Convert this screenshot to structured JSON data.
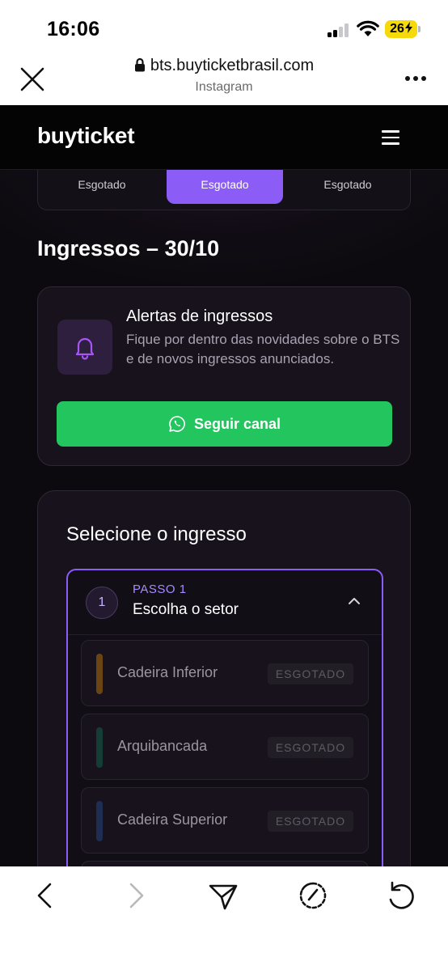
{
  "status_bar": {
    "time": "16:06",
    "battery": "26",
    "icons": [
      "cellular-signal-icon",
      "wifi-icon",
      "battery-charging-icon"
    ]
  },
  "browser": {
    "url": "bts.buyticketbrasil.com",
    "source": "Instagram",
    "icons": [
      "close-icon",
      "lock-icon",
      "more-icon"
    ]
  },
  "site": {
    "logo": "buyticket",
    "accent_color": "#8b5cf6",
    "tabs": [
      {
        "label": "Esgotado"
      },
      {
        "label": "Esgotado"
      },
      {
        "label": "Esgotado"
      }
    ],
    "section_title": "Ingressos – 30/10"
  },
  "alert": {
    "title": "Alertas de ingressos",
    "description": "Fique por dentro das novidades sobre o BTS e de novos ingressos anunciados.",
    "button_label": "Seguir canal",
    "button_color": "#22c55e"
  },
  "selection": {
    "title": "Selecione o ingresso",
    "step_number": "1",
    "step_label": "PASSO 1",
    "step_title": "Escolha o setor",
    "sectors": [
      {
        "name": "Cadeira Inferior",
        "status": "ESGOTADO",
        "color": "#6b4414"
      },
      {
        "name": "Arquibancada",
        "status": "ESGOTADO",
        "color": "#153d36"
      },
      {
        "name": "Cadeira Superior",
        "status": "ESGOTADO",
        "color": "#1e2d52"
      }
    ]
  },
  "toolbar": {
    "icons": [
      "back-icon",
      "forward-icon",
      "share-icon",
      "speed-icon",
      "reload-icon"
    ]
  }
}
